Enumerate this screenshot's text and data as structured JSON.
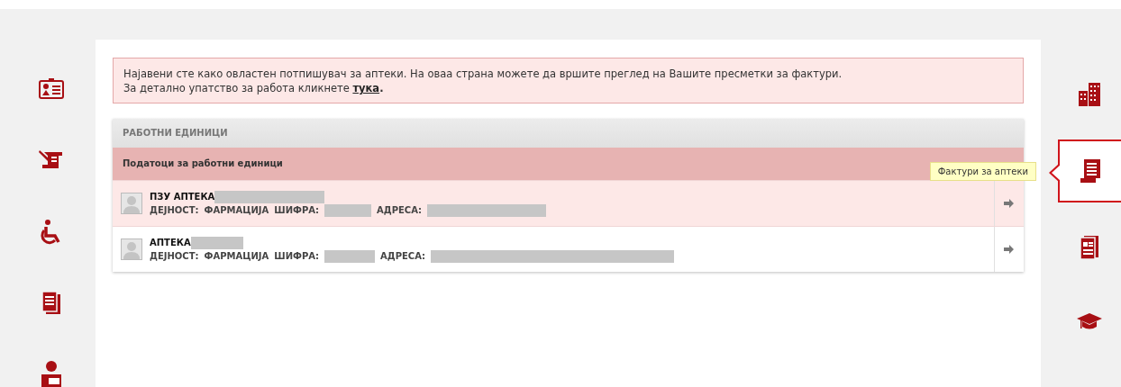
{
  "left_nav": [
    {
      "selected": false
    },
    {
      "selected": false
    },
    {
      "selected": false
    },
    {
      "selected": false
    },
    {
      "selected": false
    }
  ],
  "notice": {
    "line_1": "Најавени сте како овластен потпишувач за аптеки. На оваа страна можете да вршите преглед на Вашите пресметки за фактури.",
    "line_2": {
      "text": "За детално упатство за работа кликнете",
      "link": "тука",
      "after": "."
    }
  },
  "panel": {
    "title": "РАБОТНИ ЕДИНИЦИ",
    "subheader": "Податоци за работни единици",
    "units": [
      {
        "name": "ПЗУ АПТЕКА",
        "name_redacted": true,
        "selected": true,
        "fields": [
          {
            "label": "ДЕЈНОСТ:",
            "value": "ФАРМАЦИЈА"
          },
          {
            "label": "ШИФРА:",
            "redacted": true
          },
          {
            "label": "АДРЕСА:",
            "redacted": true
          }
        ]
      },
      {
        "name": "АПТЕКА",
        "name_redacted": true,
        "selected": false,
        "fields": [
          {
            "label": "ДЕЈНОСТ:",
            "value": "ФАРМАЦИЈА"
          },
          {
            "label": "ШИФРА:",
            "redacted": true
          },
          {
            "label": "АДРЕСА:",
            "redacted": true
          }
        ]
      }
    ]
  },
  "right_nav": [
    {
      "selected": false
    },
    {
      "selected": true,
      "tooltip": "Фактури за аптеки"
    },
    {
      "selected": false
    },
    {
      "selected": false
    }
  ]
}
